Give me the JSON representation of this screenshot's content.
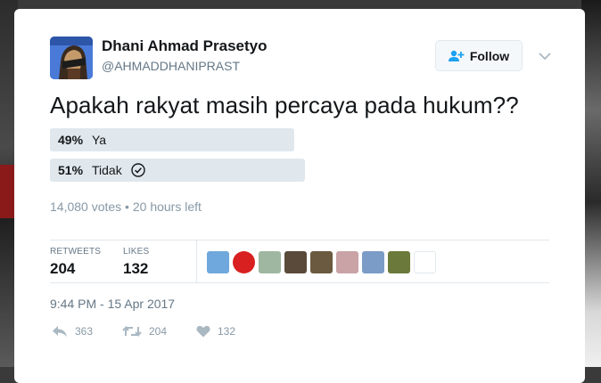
{
  "author": {
    "display_name": "Dhani Ahmad Prasetyo",
    "handle": "@AHMADDHANIPRAST"
  },
  "follow_button": {
    "label": "Follow",
    "icon": "add-user-icon"
  },
  "tweet": {
    "text": "Apakah rakyat masih percaya pada hukum??"
  },
  "poll": {
    "options": [
      {
        "percent": "49%",
        "label": "Ya",
        "share": 0.49,
        "winner": false
      },
      {
        "percent": "51%",
        "label": "Tidak",
        "share": 0.51,
        "winner": true
      }
    ],
    "meta": "14,080 votes • 20 hours left"
  },
  "stats": {
    "retweets_label": "RETWEETS",
    "retweets_value": "204",
    "likes_label": "LIKES",
    "likes_value": "132"
  },
  "likers": [
    {
      "name": "liker-1",
      "color": "#6fa8dc"
    },
    {
      "name": "liker-2",
      "color": "#d92020"
    },
    {
      "name": "liker-3",
      "color": "#9fb7a0"
    },
    {
      "name": "liker-4",
      "color": "#5a4a3a"
    },
    {
      "name": "liker-5",
      "color": "#6b5a40"
    },
    {
      "name": "liker-6",
      "color": "#c9a3a6"
    },
    {
      "name": "liker-7",
      "color": "#7a9cc6"
    },
    {
      "name": "liker-8",
      "color": "#6b7a3a"
    },
    {
      "name": "liker-9",
      "color": "#ffffff"
    }
  ],
  "timestamp": "9:44 PM - 15 Apr 2017",
  "actions": {
    "reply_count": "363",
    "retweet_count": "204",
    "like_count": "132"
  },
  "colors": {
    "poll_bar": "#e1e8ed",
    "muted_text": "#8899a6",
    "divider": "#e1e8ed"
  }
}
